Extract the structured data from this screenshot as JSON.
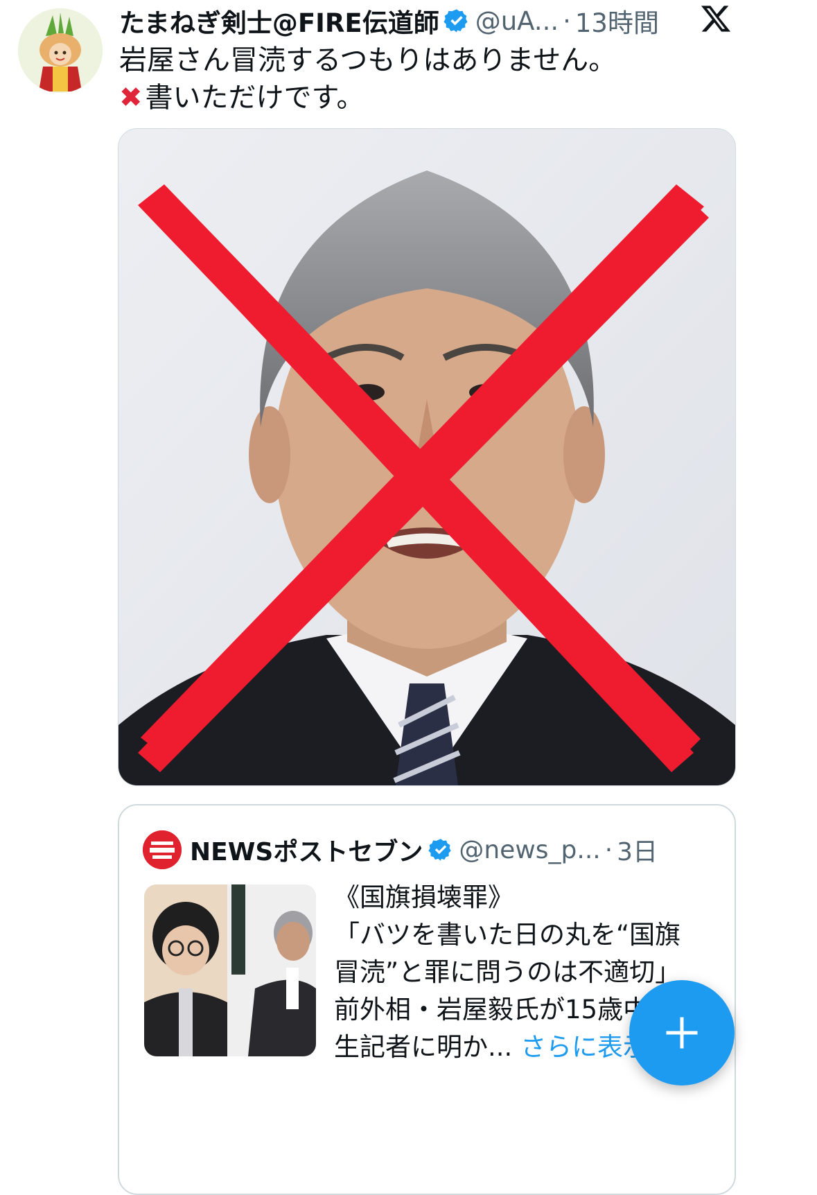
{
  "tweet": {
    "author_name": "たまねぎ剣士@FIRE伝道師",
    "author_handle": "@uA...",
    "separator": "·",
    "time": "13時間",
    "text_line1": "岩屋さん冒涜するつもりはありません。",
    "text_line2_emoji": "✖",
    "text_line2": "書いただけです。",
    "media_icon": "photo-with-red-x"
  },
  "quote": {
    "author_name": "NEWSポストセブン",
    "author_handle": "@news_p...",
    "separator": "·",
    "time": "3日",
    "lines": [
      "《国旗損壊罪》",
      "「バツを書いた日の丸を“国旗",
      "冒涜”と罪に問うのは不適切」",
      "前外相・岩屋毅氏が15歳中",
      "生記者に明か..."
    ],
    "more_label": "さらに表示"
  },
  "colors": {
    "accent": "#1d9bf0",
    "verified": "#1d9bf0",
    "red_x": "#ee1c2e",
    "secondary_text": "#536471"
  },
  "icons": {
    "verified": "verified-badge-icon",
    "platform": "x-logo-icon",
    "compose": "plus-icon"
  }
}
